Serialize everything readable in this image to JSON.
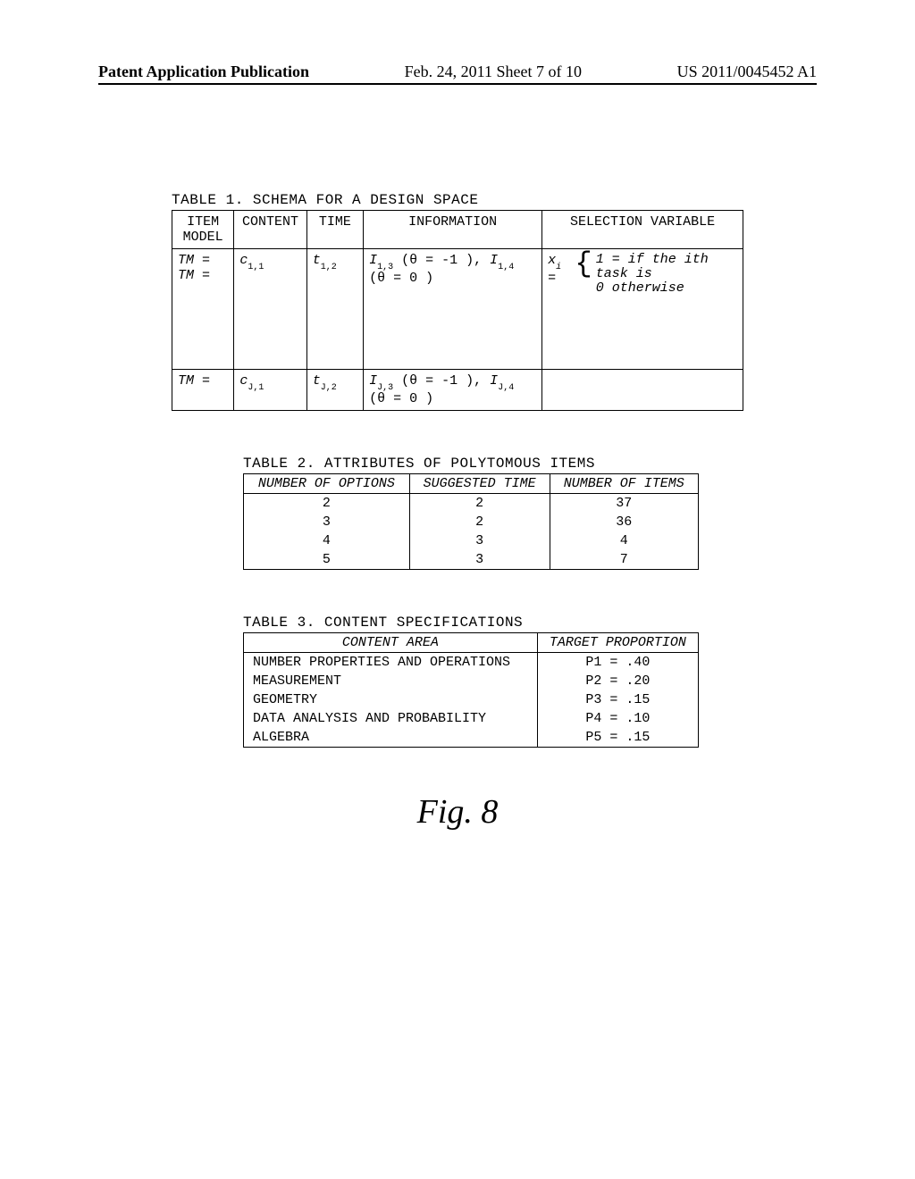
{
  "header": {
    "left": "Patent Application Publication",
    "mid": "Feb. 24, 2011  Sheet 7 of 10",
    "right": "US 2011/0045452 A1"
  },
  "table1": {
    "caption": "TABLE 1. SCHEMA FOR A DESIGN SPACE",
    "headers": {
      "item_model": "ITEM MODEL",
      "content": "CONTENT",
      "time": "TIME",
      "information": "INFORMATION",
      "selection": "SELECTION VARIABLE"
    },
    "row1": {
      "im_top": "TM =",
      "im_bot": "TM =",
      "content": "c₁,₁",
      "time": "t₁,₂",
      "info": "I₁,₃ (θ = -1 ), I₁,₄ (θ = 0 )",
      "sel_prefix": "xᵢ =",
      "sel_line1": "1 = if the ith task is",
      "sel_line2": "0 otherwise"
    },
    "row2": {
      "im": "TM =",
      "content": "cⱼ,₁",
      "time": "tⱼ,₂",
      "info": "Iⱼ,₃ (θ = -1 ), Iⱼ,₄ (θ = 0 )",
      "sel": ""
    }
  },
  "table2": {
    "caption": "TABLE 2. ATTRIBUTES OF POLYTOMOUS ITEMS",
    "headers": {
      "options": "NUMBER OF OPTIONS",
      "time": "SUGGESTED TIME",
      "items": "NUMBER OF ITEMS"
    },
    "rows": [
      {
        "options": "2",
        "time": "2",
        "items": "37"
      },
      {
        "options": "3",
        "time": "2",
        "items": "36"
      },
      {
        "options": "4",
        "time": "3",
        "items": "4"
      },
      {
        "options": "5",
        "time": "3",
        "items": "7"
      }
    ]
  },
  "table3": {
    "caption": "TABLE 3. CONTENT SPECIFICATIONS",
    "headers": {
      "area": "CONTENT AREA",
      "prop": "TARGET PROPORTION"
    },
    "rows": [
      {
        "area": "NUMBER PROPERTIES AND OPERATIONS",
        "prop": "P1 = .40"
      },
      {
        "area": "MEASUREMENT",
        "prop": "P2 = .20"
      },
      {
        "area": "GEOMETRY",
        "prop": "P3 = .15"
      },
      {
        "area": "DATA ANALYSIS AND PROBABILITY",
        "prop": "P4 = .10"
      },
      {
        "area": "ALGEBRA",
        "prop": "P5 = .15"
      }
    ]
  },
  "figure_label": "Fig. 8"
}
